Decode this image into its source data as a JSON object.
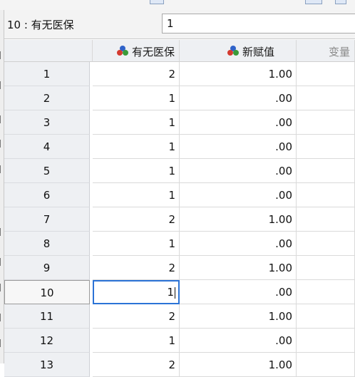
{
  "editor": {
    "cell_reference": "10 : 有无医保",
    "cell_value": "1"
  },
  "grid": {
    "columns": [
      {
        "label": "有无医保",
        "icon": "nominal-variable-icon"
      },
      {
        "label": "新赋值",
        "icon": "nominal-variable-icon"
      },
      {
        "label": "变量",
        "icon": ""
      }
    ],
    "rows": [
      {
        "num": "1",
        "c1": "2",
        "c2": "1.00",
        "c3": ""
      },
      {
        "num": "2",
        "c1": "1",
        "c2": ".00",
        "c3": ""
      },
      {
        "num": "3",
        "c1": "1",
        "c2": ".00",
        "c3": ""
      },
      {
        "num": "4",
        "c1": "1",
        "c2": ".00",
        "c3": ""
      },
      {
        "num": "5",
        "c1": "1",
        "c2": ".00",
        "c3": ""
      },
      {
        "num": "6",
        "c1": "1",
        "c2": ".00",
        "c3": ""
      },
      {
        "num": "7",
        "c1": "2",
        "c2": "1.00",
        "c3": ""
      },
      {
        "num": "8",
        "c1": "1",
        "c2": ".00",
        "c3": ""
      },
      {
        "num": "9",
        "c1": "2",
        "c2": "1.00",
        "c3": ""
      },
      {
        "num": "10",
        "c1": "1",
        "c2": ".00",
        "c3": ""
      },
      {
        "num": "11",
        "c1": "2",
        "c2": "1.00",
        "c3": ""
      },
      {
        "num": "12",
        "c1": "1",
        "c2": ".00",
        "c3": ""
      },
      {
        "num": "13",
        "c1": "2",
        "c2": "1.00",
        "c3": ""
      }
    ],
    "selected_row": "10"
  },
  "colors": {
    "selection_border": "#2b73d6",
    "header_background": "#eef0f3",
    "icon_red": "#d43a2f",
    "icon_green": "#3a9a3a",
    "icon_blue": "#2f62c9"
  }
}
